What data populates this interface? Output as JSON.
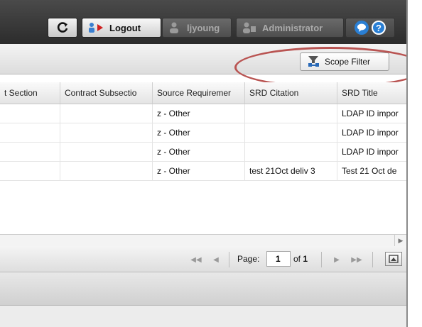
{
  "topbar": {
    "logout_label": "Logout",
    "user_label": "ljyoung",
    "admin_label": "Administrator"
  },
  "toolbar": {
    "scope_filter_label": "Scope Filter"
  },
  "grid": {
    "columns": [
      "t Section",
      "Contract Subsectio",
      "Source Requiremer",
      "SRD Citation",
      "SRD Title"
    ],
    "rows": [
      [
        "",
        "",
        "z - Other",
        "",
        "LDAP ID impor"
      ],
      [
        "",
        "",
        "z - Other",
        "",
        "LDAP ID impor"
      ],
      [
        "",
        "",
        "z - Other",
        "",
        "LDAP ID impor"
      ],
      [
        "",
        "",
        "z - Other",
        "test 21Oct deliv 3",
        "Test 21 Oct de"
      ]
    ]
  },
  "pager": {
    "page_label": "Page:",
    "page_value": "1",
    "of_label": "of",
    "total_pages": "1"
  },
  "colors": {
    "highlight_ellipse": "#b95452",
    "topbar_bg": "#333333"
  }
}
